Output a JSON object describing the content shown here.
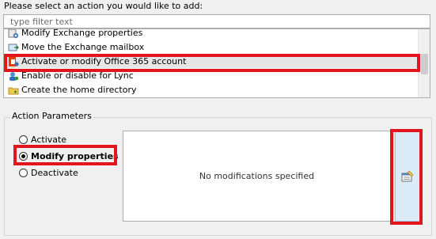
{
  "prompt_label": "Please select an action you would like to add:",
  "filter": {
    "placeholder": "type filter text",
    "value": ""
  },
  "actions": [
    {
      "label": "Modify Exchange properties",
      "icon": "exchange-properties-icon",
      "selected": false
    },
    {
      "label": "Move the Exchange mailbox",
      "icon": "move-mailbox-icon",
      "selected": false
    },
    {
      "label": "Activate or modify Office 365 account",
      "icon": "office365-account-icon",
      "selected": true
    },
    {
      "label": "Enable or disable for Lync",
      "icon": "lync-icon",
      "selected": false
    },
    {
      "label": "Create the home directory",
      "icon": "home-directory-icon",
      "selected": false
    }
  ],
  "action_parameters": {
    "legend": "Action Parameters",
    "options": [
      {
        "label": "Activate",
        "checked": false
      },
      {
        "label": "Modify properties",
        "checked": true
      },
      {
        "label": "Deactivate",
        "checked": false
      }
    ],
    "modifications_text": "No modifications specified",
    "edit_icon": "edit-properties-icon"
  },
  "colors": {
    "highlight": "#e3141c",
    "selected_row": "#e6e6e6",
    "edit_button": "#dcebf8"
  }
}
